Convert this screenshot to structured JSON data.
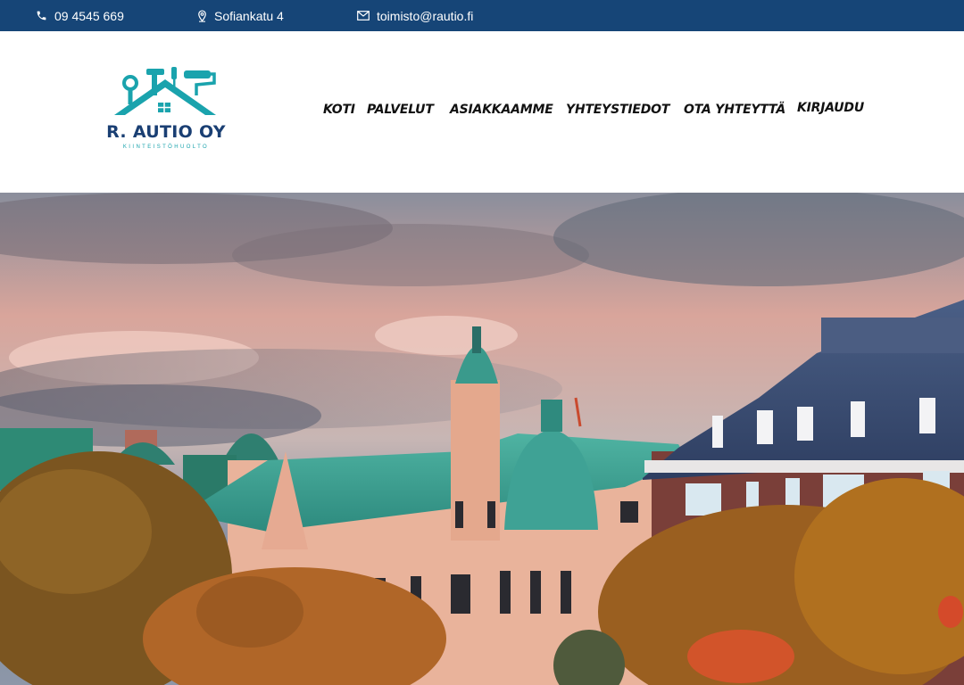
{
  "topbar": {
    "phone": "09 4545 669",
    "address": "Sofiankatu 4",
    "email": "toimisto@rautio.fi",
    "phone_icon": "phone-icon",
    "address_icon": "map-pin-icon",
    "email_icon": "envelope-icon",
    "background": "#164577"
  },
  "logo": {
    "name": "R. AUTIO OY",
    "tagline": "KIINTEISTÖHUOLTO",
    "icon": "tools-house-logo",
    "primary_color": "#1a3f73",
    "accent_color": "#1aa3ad"
  },
  "nav": {
    "items": [
      {
        "label": "KOTI"
      },
      {
        "label": "PALVELUT"
      },
      {
        "label": "ASIAKKAAMME"
      },
      {
        "label": "YHTEYSTIEDOT"
      },
      {
        "label": "OTA YHTEYTTÄ"
      },
      {
        "label": "KIRJAUDU"
      }
    ]
  },
  "hero": {
    "image": "helsinki-rooftops-autumn-photo"
  }
}
